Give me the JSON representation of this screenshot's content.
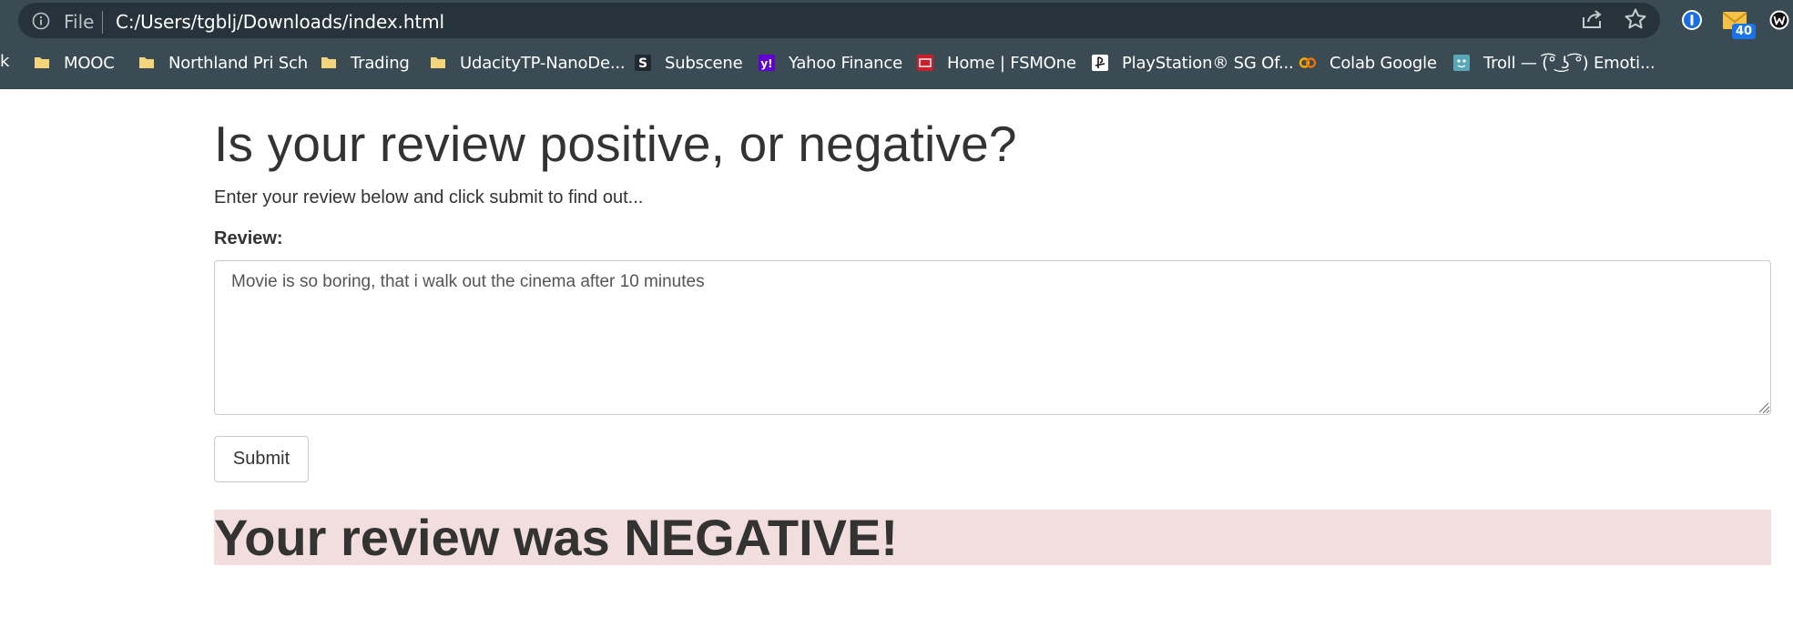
{
  "browser": {
    "address_bar": {
      "scheme_label": "File",
      "url": "C:/Users/tgblj/Downloads/index.html"
    },
    "toolbar_icons": [
      "info-icon",
      "share-icon",
      "star-icon",
      "1password-icon",
      "mail-icon",
      "w-extension-icon"
    ],
    "mail_badge_count": "40",
    "bookmarks_fragment": "k",
    "bookmarks": [
      {
        "label": "MOOC",
        "icon": "folder-icon"
      },
      {
        "label": "Northland Pri Sch",
        "icon": "folder-icon"
      },
      {
        "label": "Trading",
        "icon": "folder-icon"
      },
      {
        "label": "UdacityTP-NanoDe...",
        "icon": "folder-icon"
      },
      {
        "label": "Subscene",
        "icon": "subscene-icon"
      },
      {
        "label": "Yahoo Finance",
        "icon": "yahoo-icon"
      },
      {
        "label": "Home | FSMOne",
        "icon": "fsmone-icon"
      },
      {
        "label": "PlayStation® SG Of...",
        "icon": "playstation-icon"
      },
      {
        "label": "Colab Google",
        "icon": "colab-icon"
      },
      {
        "label": "Troll — (͡° ͜ʖ ͡°) Emoti...",
        "icon": "troll-icon"
      }
    ],
    "colors": {
      "chrome_bg": "#3b4b54",
      "address_bg": "#26333a",
      "folder": "#f4d47c",
      "yahoo": "#6001d2",
      "fsmone": "#c8202a",
      "colab": "#f9ab00"
    }
  },
  "page": {
    "title": "Is your review positive, or negative?",
    "subtitle": "Enter your review below and click submit to find out...",
    "review_label": "Review:",
    "review_value": "Movie is so boring, that i walk out the cinema after 10 minutes",
    "submit_label": "Submit",
    "result_text": "Your review was NEGATIVE!",
    "colors": {
      "text": "#333333",
      "result_bg": "#f2dede"
    }
  }
}
